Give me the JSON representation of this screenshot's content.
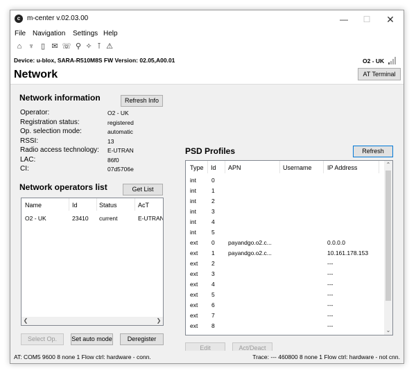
{
  "window": {
    "title": "m-center v.02.03.00",
    "app_icon": "c"
  },
  "menu": [
    "File",
    "Navigation",
    "Settings",
    "Help"
  ],
  "toolbar_icons": [
    "home-icon",
    "cell-tower-icon",
    "sim-card-icon",
    "envelope-icon",
    "phone-icon",
    "network-icon",
    "satellite-icon",
    "gps-antenna-icon",
    "warning-icon"
  ],
  "device_bar": {
    "device": "Device: u-blox, SARA-R510M8S   FW Version: 02.05,A00.01",
    "operator": "O2 - UK"
  },
  "page": {
    "title": "Network",
    "at_terminal": "AT Terminal"
  },
  "network_info": {
    "title": "Network information",
    "refresh_label": "Refresh Info",
    "rows": [
      {
        "label": "Operator:",
        "value": "O2 - UK"
      },
      {
        "label": "Registration status:",
        "value": "registered"
      },
      {
        "label": "Op. selection mode:",
        "value": "automatic"
      },
      {
        "label": "RSSI:",
        "value": "13"
      },
      {
        "label": "Radio access technology:",
        "value": "E-UTRAN"
      },
      {
        "label": "LAC:",
        "value": "86f0"
      },
      {
        "label": "CI:",
        "value": "07d5706e"
      }
    ]
  },
  "operators": {
    "title": "Network operators list",
    "get_list_label": "Get List",
    "columns": [
      "Name",
      "Id",
      "Status",
      "AcT"
    ],
    "rows": [
      [
        "O2 - UK",
        "23410",
        "current",
        "E-UTRAN"
      ]
    ],
    "select_op_label": "Select Op.",
    "set_auto_label": "Set auto mode",
    "deregister_label": "Deregister"
  },
  "psd": {
    "title": "PSD Profiles",
    "refresh_label": "Refresh",
    "columns": [
      "Type",
      "Id",
      "APN",
      "Username",
      "IP Address"
    ],
    "rows": [
      [
        "int",
        "0",
        "",
        "",
        ""
      ],
      [
        "int",
        "1",
        "",
        "",
        ""
      ],
      [
        "int",
        "2",
        "",
        "",
        ""
      ],
      [
        "int",
        "3",
        "",
        "",
        ""
      ],
      [
        "int",
        "4",
        "",
        "",
        ""
      ],
      [
        "int",
        "5",
        "",
        "",
        ""
      ],
      [
        "ext",
        "0",
        "payandgo.o2.c...",
        "",
        "0.0.0.0"
      ],
      [
        "ext",
        "1",
        "payandgo.o2.c...",
        "",
        "10.161.178.153"
      ],
      [
        "ext",
        "2",
        "",
        "",
        "---"
      ],
      [
        "ext",
        "3",
        "",
        "",
        "---"
      ],
      [
        "ext",
        "4",
        "",
        "",
        "---"
      ],
      [
        "ext",
        "5",
        "",
        "",
        "---"
      ],
      [
        "ext",
        "6",
        "",
        "",
        "---"
      ],
      [
        "ext",
        "7",
        "",
        "",
        "---"
      ],
      [
        "ext",
        "8",
        "",
        "",
        "---"
      ]
    ],
    "edit_label": "Edit",
    "actdeact_label": "Act/Deact"
  },
  "statusbar": {
    "left": "AT: COM5 9600 8 none 1 Flow ctrl: hardware - conn.",
    "right": "Trace: --- 460800 8 none 1 Flow ctrl: hardware - not cnn."
  }
}
